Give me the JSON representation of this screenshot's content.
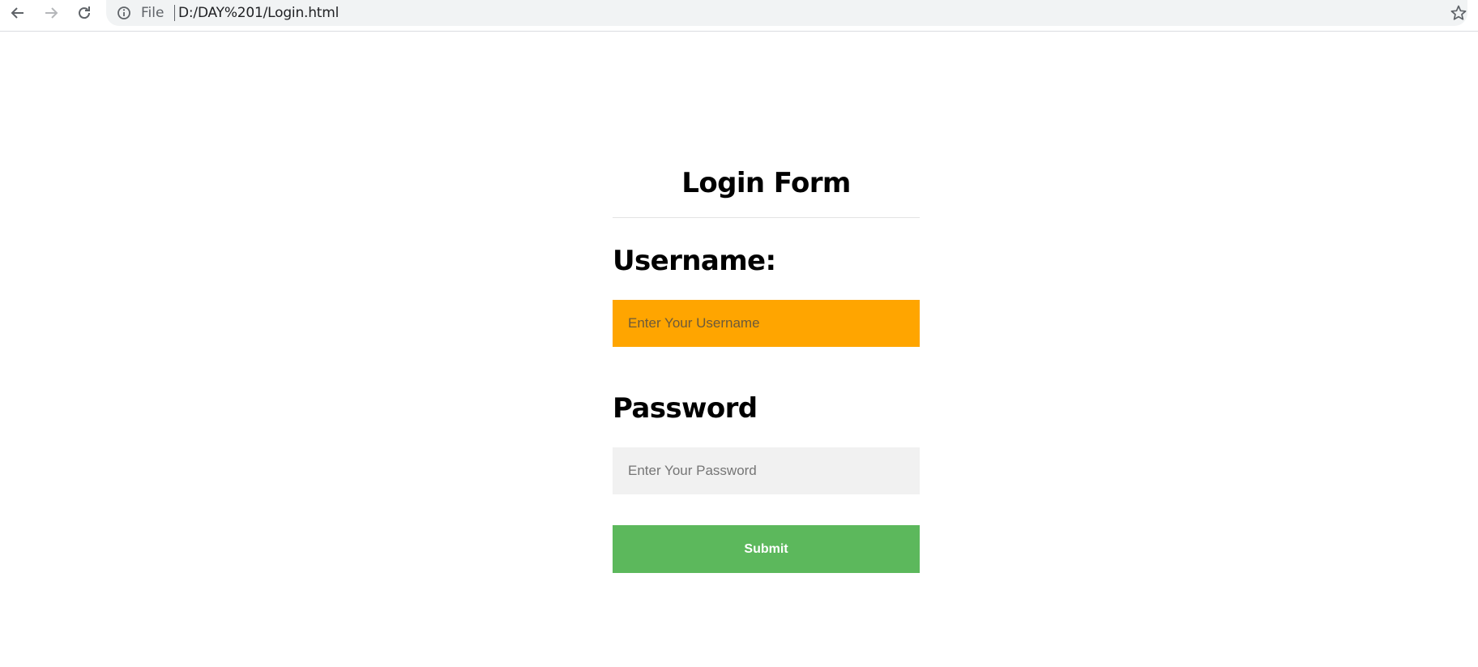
{
  "browser": {
    "scheme_label": "File",
    "url": "D:/DAY%201/Login.html"
  },
  "icons": {
    "back": "arrow-left",
    "forward": "arrow-right",
    "reload": "refresh",
    "site_info": "info-circle",
    "bookmark": "star-outline"
  },
  "form": {
    "title": "Login Form",
    "username_label": "Username:",
    "username_placeholder": "Enter Your Username",
    "username_value": "",
    "password_label": "Password",
    "password_placeholder": "Enter Your Password",
    "password_value": "",
    "submit_label": "Submit"
  },
  "colors": {
    "username_field_bg": "#ffa500",
    "password_field_bg": "#f1f1f1",
    "submit_bg": "#5cb85c",
    "submit_text": "#ffffff"
  }
}
